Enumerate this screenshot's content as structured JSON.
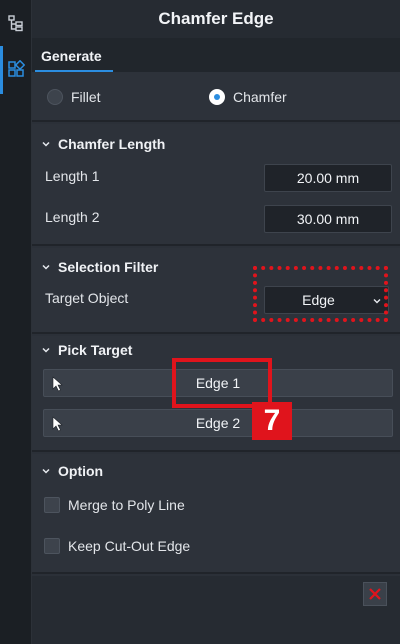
{
  "rail": {
    "icons": [
      "tree-icon",
      "layout-icon"
    ]
  },
  "panel": {
    "title": "Chamfer Edge"
  },
  "tabs": [
    {
      "label": "Generate",
      "active": true
    }
  ],
  "mode": {
    "options": [
      {
        "label": "Fillet",
        "selected": false
      },
      {
        "label": "Chamfer",
        "selected": true
      }
    ]
  },
  "chamfer_length": {
    "title": "Chamfer Length",
    "length1": {
      "label": "Length 1",
      "value": "20.00 mm"
    },
    "length2": {
      "label": "Length 2",
      "value": "30.00 mm"
    }
  },
  "selection_filter": {
    "title": "Selection Filter",
    "target_label": "Target Object",
    "target_value": "Edge"
  },
  "pick_target": {
    "title": "Pick Target",
    "items": [
      {
        "label": "Edge 1"
      },
      {
        "label": "Edge 2"
      }
    ]
  },
  "annotation": {
    "step": "7",
    "color": "#e0141c"
  },
  "option": {
    "title": "Option",
    "merge_label": "Merge to Poly Line",
    "keep_label": "Keep Cut-Out Edge",
    "merge_checked": false,
    "keep_checked": false
  },
  "colors": {
    "accent": "#2b8de0",
    "close": "#e0141c"
  }
}
